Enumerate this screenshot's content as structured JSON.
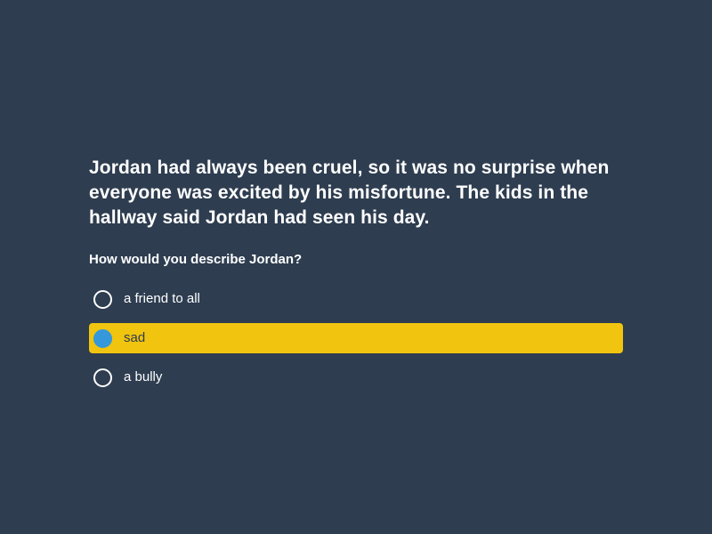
{
  "passage": "Jordan had always been cruel, so it was no surprise when everyone was excited by his misfortune. The kids in the hallway said Jordan had seen his day.",
  "question": "How would you describe Jordan?",
  "options": [
    {
      "label": "a friend to all",
      "selected": false
    },
    {
      "label": "sad",
      "selected": true
    },
    {
      "label": "a bully",
      "selected": false
    }
  ],
  "colors": {
    "background": "#2e3d50",
    "selected_highlight": "#f1c40f",
    "selected_radio": "#3498db",
    "text": "#ffffff"
  }
}
